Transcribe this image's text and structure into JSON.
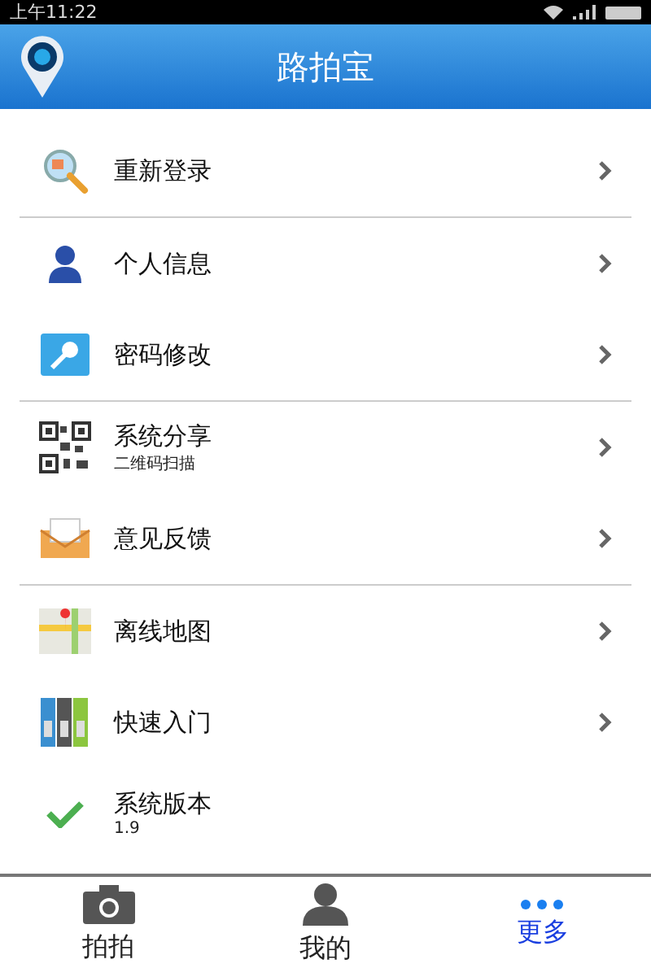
{
  "status_bar": {
    "time": "上午11:22"
  },
  "header": {
    "title": "路拍宝"
  },
  "menu_groups": [
    [
      {
        "kind": "nav",
        "label": "重新登录"
      }
    ],
    [
      {
        "kind": "nav",
        "label": "个人信息"
      },
      {
        "kind": "nav",
        "label": "密码修改"
      }
    ],
    [
      {
        "kind": "nav",
        "label": "系统分享",
        "sublabel": "二维码扫描"
      },
      {
        "kind": "nav",
        "label": "意见反馈"
      }
    ],
    [
      {
        "kind": "nav",
        "label": "离线地图"
      },
      {
        "kind": "nav",
        "label": "快速入门"
      },
      {
        "kind": "info",
        "label": "系统版本",
        "sublabel": "1.9"
      }
    ]
  ],
  "tabs": [
    {
      "label": "拍拍",
      "selected": false
    },
    {
      "label": "我的",
      "selected": false
    },
    {
      "label": "更多",
      "selected": true
    }
  ]
}
